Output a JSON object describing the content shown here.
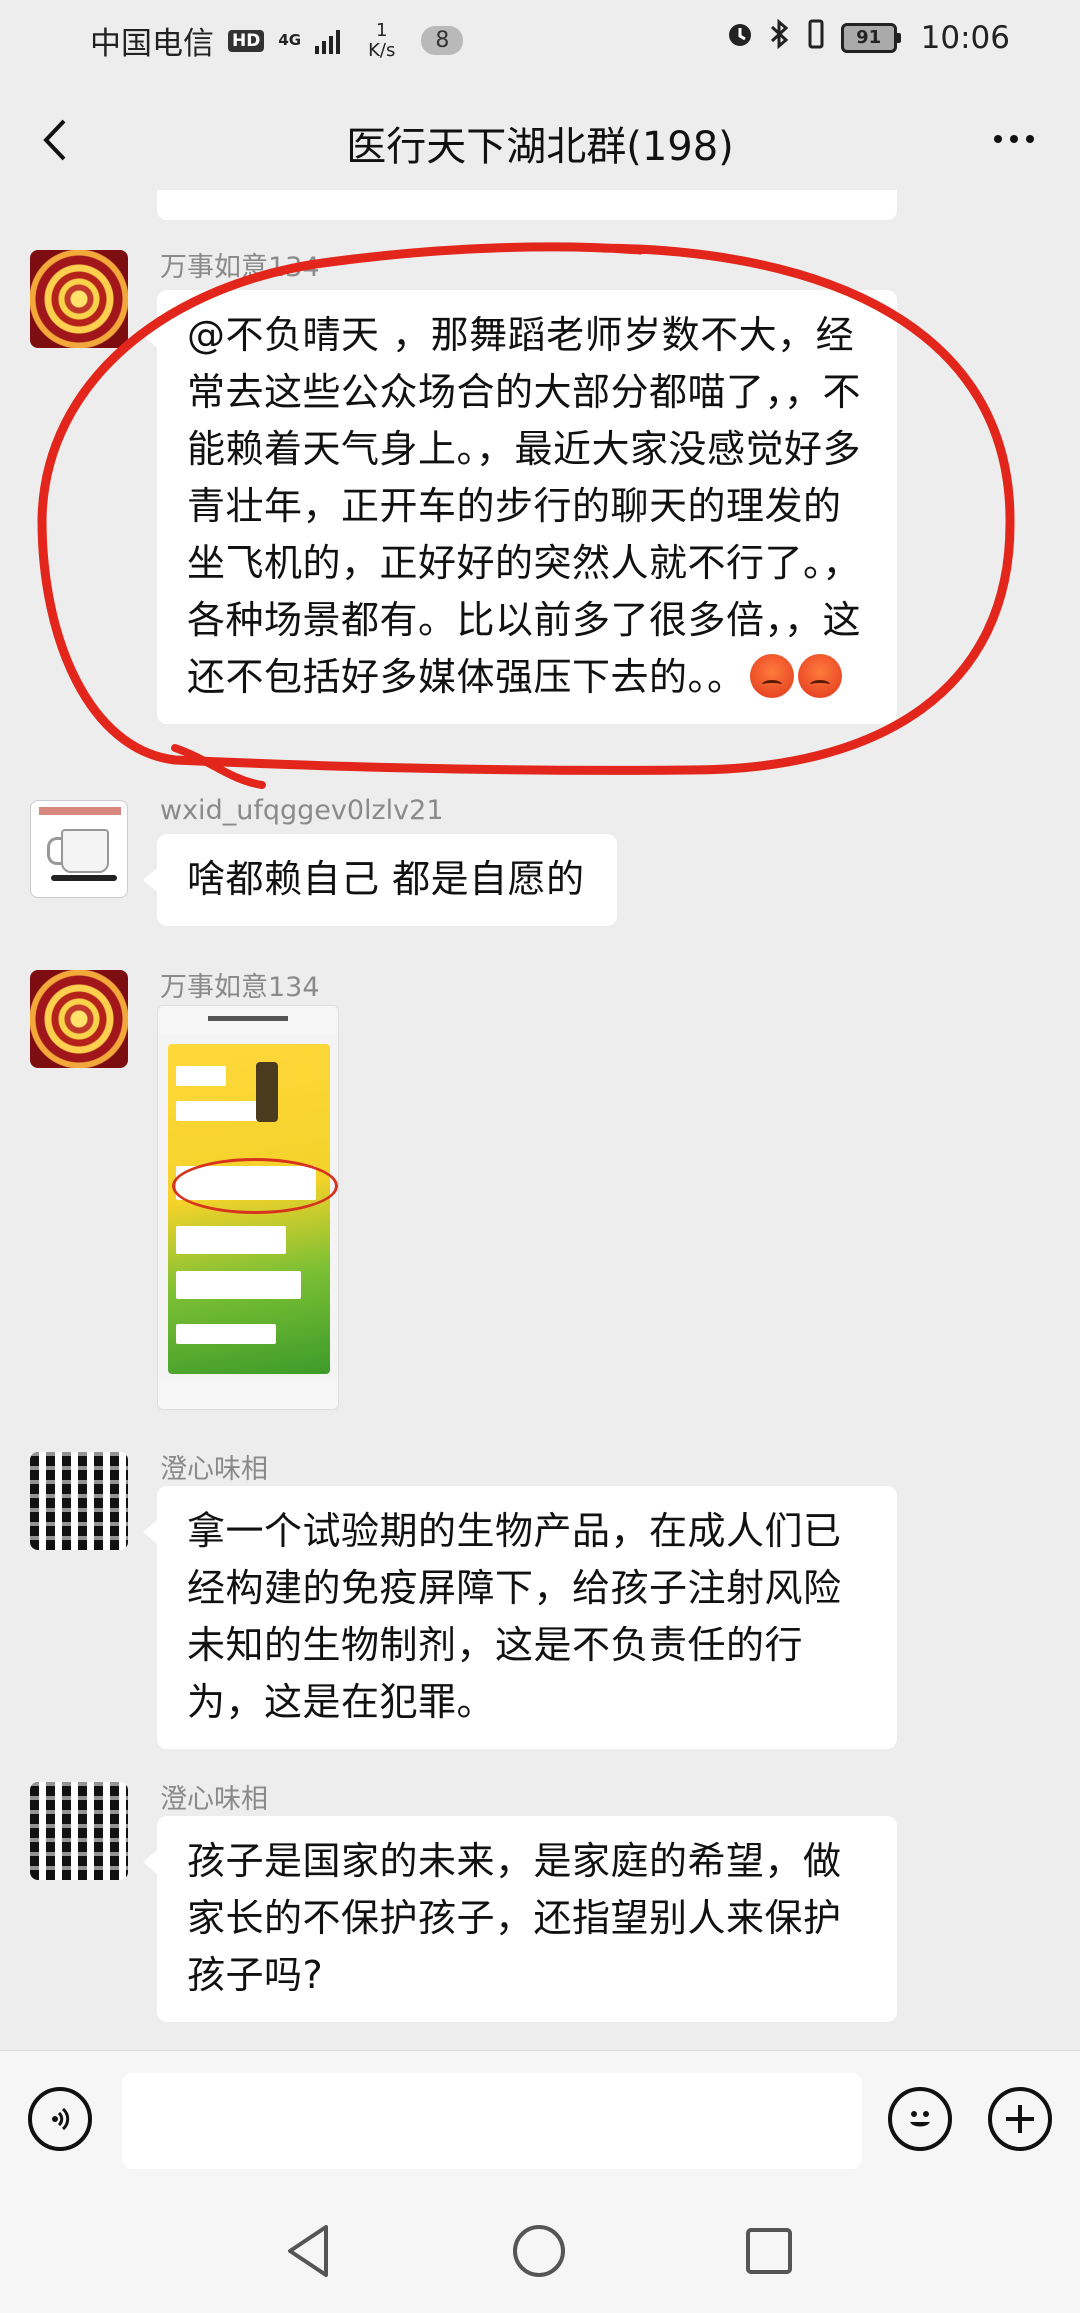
{
  "status_bar": {
    "carrier": "中国电信",
    "hd": "HD",
    "network_type": "4G",
    "speed_value": "1",
    "speed_unit": "K/s",
    "notification_count": "8",
    "battery": "91",
    "time": "10:06"
  },
  "nav": {
    "title": "医行天下湖北群(198)"
  },
  "messages": [
    {
      "sender": "万事如意134",
      "text": "@不负晴天 ，那舞蹈老师岁数不大，经常去这些公众场合的大部分都喵了，，不能赖着天气身上。，最近大家没感觉好多青壮年，正开车的步行的聊天的理发的坐飞机的，正好好的突然人就不行了。，各种场景都有。比以前多了很多倍，，这还不包括好多媒体强压下去的。。"
    },
    {
      "sender": "wxid_ufqggev0lzlv21",
      "text": "啥都赖自己 都是自愿的"
    },
    {
      "sender": "万事如意134",
      "type": "image"
    },
    {
      "sender": "澄心味相",
      "text": "拿一个试验期的生物产品，在成人们已经构建的免疫屏障下，给孩子注射风险未知的生物制剂，这是不负责任的行为，这是在犯罪。"
    },
    {
      "sender": "澄心味相",
      "text": "孩子是国家的未来，是家庭的希望，做家长的不保护孩子，还指望别人来保护孩子吗?"
    }
  ],
  "icons": {
    "back": "chevron-left-icon",
    "more": "more-dots-icon",
    "voice": "voice-icon",
    "emoji": "emoji-icon",
    "plus": "plus-icon",
    "sys_back": "triangle-back-icon",
    "sys_home": "circle-home-icon",
    "sys_recent": "square-recent-icon"
  },
  "colors": {
    "background": "#ededed",
    "bubble": "#ffffff",
    "annotation_circle": "#e3261b"
  }
}
